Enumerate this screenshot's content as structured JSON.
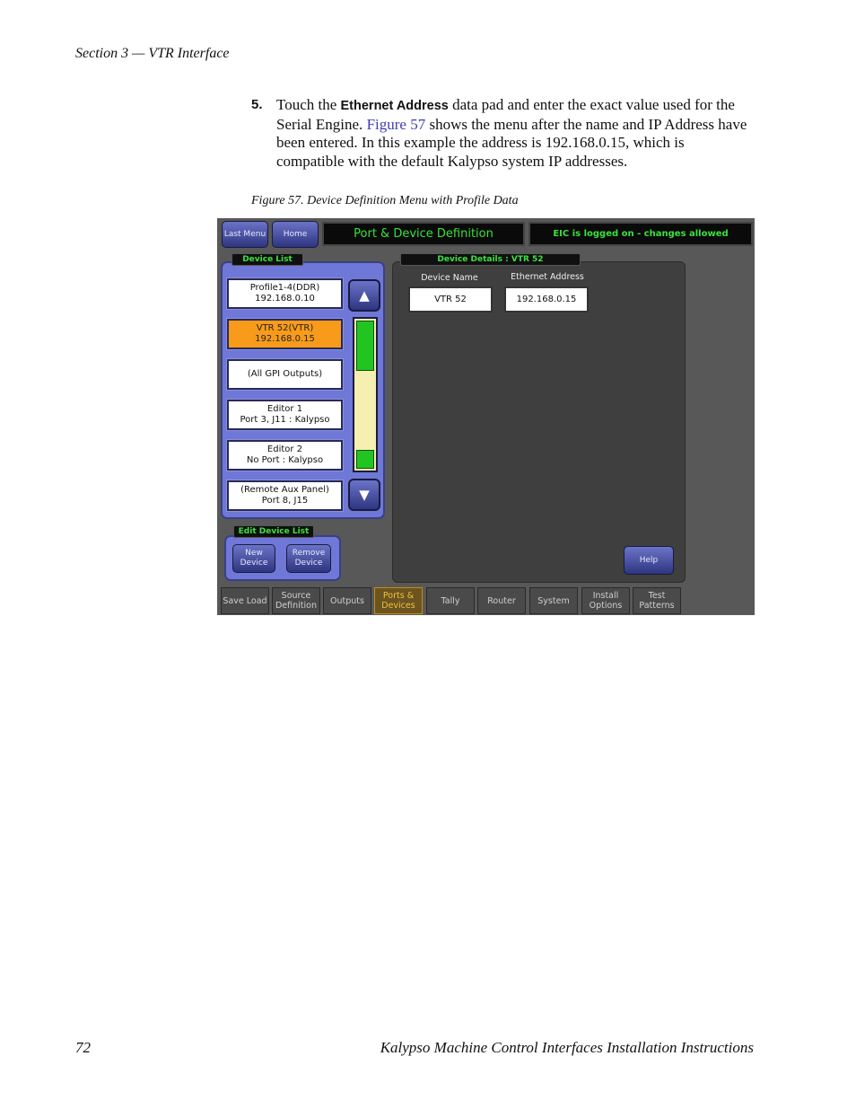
{
  "page": {
    "header": "Section 3 — VTR Interface",
    "step_number": "5.",
    "step_text_1": "Touch the ",
    "step_keyword": "Ethernet Address",
    "step_text_2": " data pad and enter the exact value used for the Serial Engine. ",
    "step_link": "Figure 57",
    "step_text_3": " shows the menu after the name and IP Address have been entered. In this example the address is 192.168.0.15, which is compatible with the default Kalypso system IP addresses.",
    "caption": "Figure 57.  Device Definition Menu with Profile Data",
    "footer_page": "72",
    "footer_title": "Kalypso Machine Control Interfaces Installation Instructions"
  },
  "screen": {
    "top": {
      "last_menu": "Last Menu",
      "home": "Home",
      "title": "Port & Device Definition",
      "status": "EIC is logged on - changes allowed"
    },
    "device_list_label": "Device List",
    "devices": [
      {
        "line1": "Profile1-4(DDR)",
        "line2": "192.168.0.10"
      },
      {
        "line1": "VTR 52(VTR)",
        "line2": "192.168.0.15"
      },
      {
        "line1": "(All GPI Outputs)",
        "line2": ""
      },
      {
        "line1": "Editor 1",
        "line2": "Port 3, J11 : Kalypso"
      },
      {
        "line1": "Editor 2",
        "line2": "No Port : Kalypso"
      },
      {
        "line1": "(Remote Aux Panel)",
        "line2": "Port 8, J15"
      }
    ],
    "edit_list_label": "Edit Device List",
    "new_device": "New Device",
    "remove_device": "Remove Device",
    "details_label": "Device Details : VTR 52",
    "device_name_label": "Device Name",
    "device_name_value": "VTR 52",
    "ethernet_label": "Ethernet Address",
    "ethernet_value": "192.168.0.15",
    "help": "Help",
    "tabs": [
      "Save Load",
      "Source Definition",
      "Outputs",
      "Ports & Devices",
      "Tally",
      "Router",
      "System",
      "Install Options",
      "Test Patterns"
    ],
    "active_tab": "Ports & Devices",
    "scroll_position": 0.35,
    "colors": {
      "accent_green": "#39e23a",
      "selected": "#f89b1a",
      "frame_blue": "#6f78d6"
    }
  }
}
